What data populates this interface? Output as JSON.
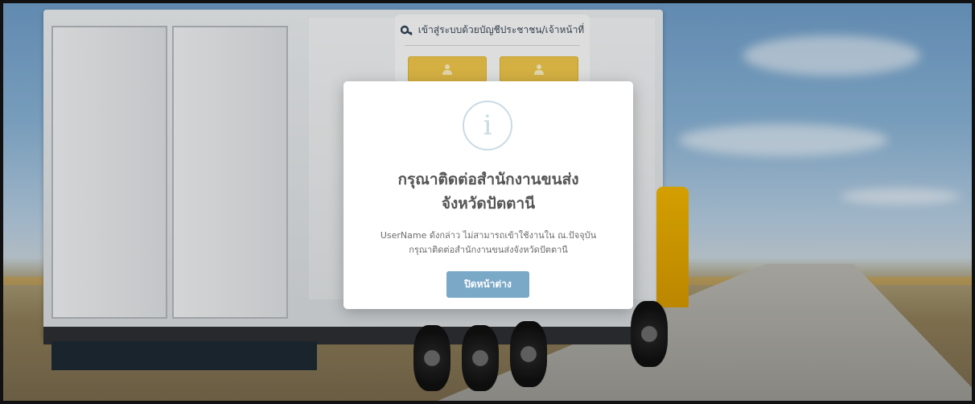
{
  "login_panel": {
    "title": "เข้าสู่ระบบด้วยบัญชีประชาชน/เจ้าหน้าที่",
    "key_icon": "key-icon",
    "user_icon": "user-icon"
  },
  "modal": {
    "icon": "info-icon",
    "icon_glyph": "i",
    "title": "กรุณาติดต่อสำนักงานขนส่ง\nจังหวัดปัตตานี",
    "message": "UserName ดังกล่าว ไม่สามารถเข้าใช้งานใน ณ.ปัจจุบัน\nกรุณาติดต่อสำนักงานขนส่งจังหวัดปัตตานี",
    "close_button_label": "ปิดหน้าต่าง"
  },
  "colors": {
    "button": "#7aa8c7",
    "login_button": "#f2c94c",
    "info_icon": "#c9dbe3"
  }
}
